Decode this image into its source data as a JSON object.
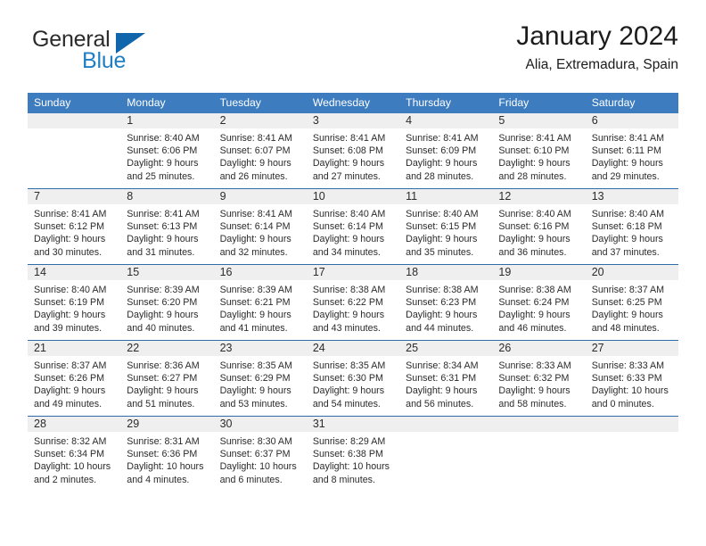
{
  "brand": {
    "word_general": "General",
    "word_blue": "Blue",
    "accent_blue": "#1f7fc4",
    "triangle_blue": "#1166ab"
  },
  "header": {
    "title": "January 2024",
    "subtitle": "Alia, Extremadura, Spain",
    "header_bg": "#3d7cbf",
    "row_divider": "#2e6da8",
    "daynum_band_bg": "#efefef"
  },
  "weekday_headers": [
    "Sunday",
    "Monday",
    "Tuesday",
    "Wednesday",
    "Thursday",
    "Friday",
    "Saturday"
  ],
  "weeks": [
    {
      "days": [
        {
          "date": "",
          "empty": true,
          "sunrise": "",
          "sunset": "",
          "daylight_line1": "",
          "daylight_line2": ""
        },
        {
          "date": "1",
          "empty": false,
          "sunrise": "Sunrise: 8:40 AM",
          "sunset": "Sunset: 6:06 PM",
          "daylight_line1": "Daylight: 9 hours",
          "daylight_line2": "and 25 minutes."
        },
        {
          "date": "2",
          "empty": false,
          "sunrise": "Sunrise: 8:41 AM",
          "sunset": "Sunset: 6:07 PM",
          "daylight_line1": "Daylight: 9 hours",
          "daylight_line2": "and 26 minutes."
        },
        {
          "date": "3",
          "empty": false,
          "sunrise": "Sunrise: 8:41 AM",
          "sunset": "Sunset: 6:08 PM",
          "daylight_line1": "Daylight: 9 hours",
          "daylight_line2": "and 27 minutes."
        },
        {
          "date": "4",
          "empty": false,
          "sunrise": "Sunrise: 8:41 AM",
          "sunset": "Sunset: 6:09 PM",
          "daylight_line1": "Daylight: 9 hours",
          "daylight_line2": "and 28 minutes."
        },
        {
          "date": "5",
          "empty": false,
          "sunrise": "Sunrise: 8:41 AM",
          "sunset": "Sunset: 6:10 PM",
          "daylight_line1": "Daylight: 9 hours",
          "daylight_line2": "and 28 minutes."
        },
        {
          "date": "6",
          "empty": false,
          "sunrise": "Sunrise: 8:41 AM",
          "sunset": "Sunset: 6:11 PM",
          "daylight_line1": "Daylight: 9 hours",
          "daylight_line2": "and 29 minutes."
        }
      ]
    },
    {
      "days": [
        {
          "date": "7",
          "empty": false,
          "sunrise": "Sunrise: 8:41 AM",
          "sunset": "Sunset: 6:12 PM",
          "daylight_line1": "Daylight: 9 hours",
          "daylight_line2": "and 30 minutes."
        },
        {
          "date": "8",
          "empty": false,
          "sunrise": "Sunrise: 8:41 AM",
          "sunset": "Sunset: 6:13 PM",
          "daylight_line1": "Daylight: 9 hours",
          "daylight_line2": "and 31 minutes."
        },
        {
          "date": "9",
          "empty": false,
          "sunrise": "Sunrise: 8:41 AM",
          "sunset": "Sunset: 6:14 PM",
          "daylight_line1": "Daylight: 9 hours",
          "daylight_line2": "and 32 minutes."
        },
        {
          "date": "10",
          "empty": false,
          "sunrise": "Sunrise: 8:40 AM",
          "sunset": "Sunset: 6:14 PM",
          "daylight_line1": "Daylight: 9 hours",
          "daylight_line2": "and 34 minutes."
        },
        {
          "date": "11",
          "empty": false,
          "sunrise": "Sunrise: 8:40 AM",
          "sunset": "Sunset: 6:15 PM",
          "daylight_line1": "Daylight: 9 hours",
          "daylight_line2": "and 35 minutes."
        },
        {
          "date": "12",
          "empty": false,
          "sunrise": "Sunrise: 8:40 AM",
          "sunset": "Sunset: 6:16 PM",
          "daylight_line1": "Daylight: 9 hours",
          "daylight_line2": "and 36 minutes."
        },
        {
          "date": "13",
          "empty": false,
          "sunrise": "Sunrise: 8:40 AM",
          "sunset": "Sunset: 6:18 PM",
          "daylight_line1": "Daylight: 9 hours",
          "daylight_line2": "and 37 minutes."
        }
      ]
    },
    {
      "days": [
        {
          "date": "14",
          "empty": false,
          "sunrise": "Sunrise: 8:40 AM",
          "sunset": "Sunset: 6:19 PM",
          "daylight_line1": "Daylight: 9 hours",
          "daylight_line2": "and 39 minutes."
        },
        {
          "date": "15",
          "empty": false,
          "sunrise": "Sunrise: 8:39 AM",
          "sunset": "Sunset: 6:20 PM",
          "daylight_line1": "Daylight: 9 hours",
          "daylight_line2": "and 40 minutes."
        },
        {
          "date": "16",
          "empty": false,
          "sunrise": "Sunrise: 8:39 AM",
          "sunset": "Sunset: 6:21 PM",
          "daylight_line1": "Daylight: 9 hours",
          "daylight_line2": "and 41 minutes."
        },
        {
          "date": "17",
          "empty": false,
          "sunrise": "Sunrise: 8:38 AM",
          "sunset": "Sunset: 6:22 PM",
          "daylight_line1": "Daylight: 9 hours",
          "daylight_line2": "and 43 minutes."
        },
        {
          "date": "18",
          "empty": false,
          "sunrise": "Sunrise: 8:38 AM",
          "sunset": "Sunset: 6:23 PM",
          "daylight_line1": "Daylight: 9 hours",
          "daylight_line2": "and 44 minutes."
        },
        {
          "date": "19",
          "empty": false,
          "sunrise": "Sunrise: 8:38 AM",
          "sunset": "Sunset: 6:24 PM",
          "daylight_line1": "Daylight: 9 hours",
          "daylight_line2": "and 46 minutes."
        },
        {
          "date": "20",
          "empty": false,
          "sunrise": "Sunrise: 8:37 AM",
          "sunset": "Sunset: 6:25 PM",
          "daylight_line1": "Daylight: 9 hours",
          "daylight_line2": "and 48 minutes."
        }
      ]
    },
    {
      "days": [
        {
          "date": "21",
          "empty": false,
          "sunrise": "Sunrise: 8:37 AM",
          "sunset": "Sunset: 6:26 PM",
          "daylight_line1": "Daylight: 9 hours",
          "daylight_line2": "and 49 minutes."
        },
        {
          "date": "22",
          "empty": false,
          "sunrise": "Sunrise: 8:36 AM",
          "sunset": "Sunset: 6:27 PM",
          "daylight_line1": "Daylight: 9 hours",
          "daylight_line2": "and 51 minutes."
        },
        {
          "date": "23",
          "empty": false,
          "sunrise": "Sunrise: 8:35 AM",
          "sunset": "Sunset: 6:29 PM",
          "daylight_line1": "Daylight: 9 hours",
          "daylight_line2": "and 53 minutes."
        },
        {
          "date": "24",
          "empty": false,
          "sunrise": "Sunrise: 8:35 AM",
          "sunset": "Sunset: 6:30 PM",
          "daylight_line1": "Daylight: 9 hours",
          "daylight_line2": "and 54 minutes."
        },
        {
          "date": "25",
          "empty": false,
          "sunrise": "Sunrise: 8:34 AM",
          "sunset": "Sunset: 6:31 PM",
          "daylight_line1": "Daylight: 9 hours",
          "daylight_line2": "and 56 minutes."
        },
        {
          "date": "26",
          "empty": false,
          "sunrise": "Sunrise: 8:33 AM",
          "sunset": "Sunset: 6:32 PM",
          "daylight_line1": "Daylight: 9 hours",
          "daylight_line2": "and 58 minutes."
        },
        {
          "date": "27",
          "empty": false,
          "sunrise": "Sunrise: 8:33 AM",
          "sunset": "Sunset: 6:33 PM",
          "daylight_line1": "Daylight: 10 hours",
          "daylight_line2": "and 0 minutes."
        }
      ]
    },
    {
      "days": [
        {
          "date": "28",
          "empty": false,
          "sunrise": "Sunrise: 8:32 AM",
          "sunset": "Sunset: 6:34 PM",
          "daylight_line1": "Daylight: 10 hours",
          "daylight_line2": "and 2 minutes."
        },
        {
          "date": "29",
          "empty": false,
          "sunrise": "Sunrise: 8:31 AM",
          "sunset": "Sunset: 6:36 PM",
          "daylight_line1": "Daylight: 10 hours",
          "daylight_line2": "and 4 minutes."
        },
        {
          "date": "30",
          "empty": false,
          "sunrise": "Sunrise: 8:30 AM",
          "sunset": "Sunset: 6:37 PM",
          "daylight_line1": "Daylight: 10 hours",
          "daylight_line2": "and 6 minutes."
        },
        {
          "date": "31",
          "empty": false,
          "sunrise": "Sunrise: 8:29 AM",
          "sunset": "Sunset: 6:38 PM",
          "daylight_line1": "Daylight: 10 hours",
          "daylight_line2": "and 8 minutes."
        },
        {
          "date": "",
          "empty": true,
          "sunrise": "",
          "sunset": "",
          "daylight_line1": "",
          "daylight_line2": ""
        },
        {
          "date": "",
          "empty": true,
          "sunrise": "",
          "sunset": "",
          "daylight_line1": "",
          "daylight_line2": ""
        },
        {
          "date": "",
          "empty": true,
          "sunrise": "",
          "sunset": "",
          "daylight_line1": "",
          "daylight_line2": ""
        }
      ]
    }
  ]
}
